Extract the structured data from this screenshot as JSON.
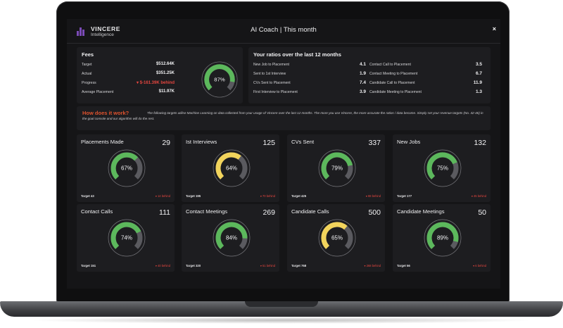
{
  "app": {
    "brand": "VINCERE",
    "brand_sub": "Intelligence",
    "title": "AI Coach | This month",
    "close_glyph": "×",
    "accent": "#7b4bb7"
  },
  "fees": {
    "heading": "Fees",
    "rows": [
      {
        "label": "Target",
        "value": "$512.64K"
      },
      {
        "label": "Actual",
        "value": "$351.25K"
      },
      {
        "label": "Progress",
        "value": "▾ $-161.39K behind"
      },
      {
        "label": "Average Placement",
        "value": "$11.97K"
      }
    ],
    "gauge": {
      "percent": 87,
      "label": "87%",
      "color": "#5cb85c"
    }
  },
  "ratios": {
    "heading": "Your ratios over the last 12 months",
    "left": [
      {
        "label": "New Job to Placement",
        "value": "4.1"
      },
      {
        "label": "Sent to 1st Interview",
        "value": "1.9"
      },
      {
        "label": "CVs Sent to Placement",
        "value": "7.4"
      },
      {
        "label": "First Interview to Placement",
        "value": "3.9"
      }
    ],
    "right": [
      {
        "label": "Contact Call to Placement",
        "value": "3.5"
      },
      {
        "label": "Contact Meeting to Placement",
        "value": "6.7"
      },
      {
        "label": "Candidate Call to Placement",
        "value": "11.9"
      },
      {
        "label": "Candidate Meeting to Placement",
        "value": "1.3"
      }
    ]
  },
  "info": {
    "question": "How does it work?",
    "text": "The following targets utilise Machine Learning on data collected from your usage of Vincere over the last 12 months. The more you use Vincere, the more accurate the ratios / data become. Simply set your revenue targets (No. 42-46) in the goal console and our algorithm will do the rest."
  },
  "colors": {
    "green": "#5cb85c",
    "yellow": "#f2d45c",
    "behind": "#e5463f"
  },
  "cards": [
    {
      "name": "Placements Made",
      "count": "29",
      "percent": 67,
      "label": "67%",
      "color": "green",
      "target": "Target 43",
      "status": "▾ 14 behind"
    },
    {
      "name": "Ist Interviews",
      "count": "125",
      "percent": 64,
      "label": "64%",
      "color": "yellow",
      "target": "Target 195",
      "status": "▾ 70 behind"
    },
    {
      "name": "CVs Sent",
      "count": "337",
      "percent": 79,
      "label": "79%",
      "color": "green",
      "target": "Target 425",
      "status": "▾ 88 behind"
    },
    {
      "name": "New Jobs",
      "count": "132",
      "percent": 75,
      "label": "75%",
      "color": "green",
      "target": "Target 177",
      "status": "▾ 45 behind"
    },
    {
      "name": "Contact Calls",
      "count": "111",
      "percent": 74,
      "label": "74%",
      "color": "green",
      "target": "Target 151",
      "status": "▾ 40 behind"
    },
    {
      "name": "Contact Meetings",
      "count": "269",
      "percent": 84,
      "label": "84%",
      "color": "green",
      "target": "Target 320",
      "status": "▾ 51 behind"
    },
    {
      "name": "Candidate Calls",
      "count": "500",
      "percent": 65,
      "label": "65%",
      "color": "yellow",
      "target": "Target 768",
      "status": "▾ 268 behind"
    },
    {
      "name": "Candidate Meetings",
      "count": "50",
      "percent": 89,
      "label": "89%",
      "color": "green",
      "target": "Target 56",
      "status": "▾ 6 behind"
    }
  ]
}
